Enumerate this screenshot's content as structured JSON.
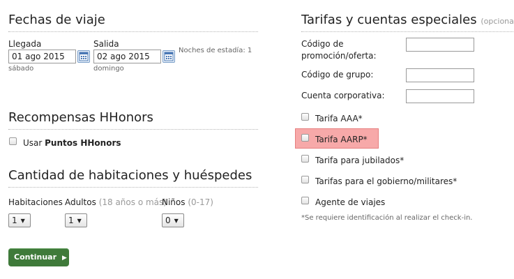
{
  "dates": {
    "title": "Fechas de viaje",
    "arrival_label": "Llegada",
    "arrival_value": "01 ago 2015",
    "arrival_day": "sábado",
    "departure_label": "Salida",
    "departure_value": "02 ago 2015",
    "departure_day": "domingo",
    "nights": "Noches de estadía: 1"
  },
  "rewards": {
    "title": "Recompensas HHonors",
    "use_prefix": "Usar ",
    "use_bold": "Puntos HHonors"
  },
  "rooms": {
    "title": "Cantidad de habitaciones y huéspedes",
    "rooms_label": "Habitaciones",
    "rooms_value": "1",
    "adults_label": "Adultos",
    "adults_note": "(18 años o más)",
    "adults_value": "1",
    "children_label": "Niños",
    "children_note": "(0-17)",
    "children_value": "0"
  },
  "continue_label": "Continuar",
  "rates": {
    "title": "Tarifas y cuentas especiales",
    "optional": "(opcional)",
    "promo_label_1": "Código de",
    "promo_label_2": "promoción/oferta:",
    "group_label": "Código de grupo:",
    "corporate_label": "Cuenta corporativa:",
    "aaa": "Tarifa AAA*",
    "aarp": "Tarifa AARP*",
    "senior": "Tarifa para jubilados*",
    "gov": "Tarifas para el gobierno/militares*",
    "travel_agent": "Agente de viajes",
    "footnote": "*Se requiere identificación al realizar el check-in."
  },
  "colors": {
    "highlight": "#f7a9a9",
    "button": "#3f7a3a"
  }
}
